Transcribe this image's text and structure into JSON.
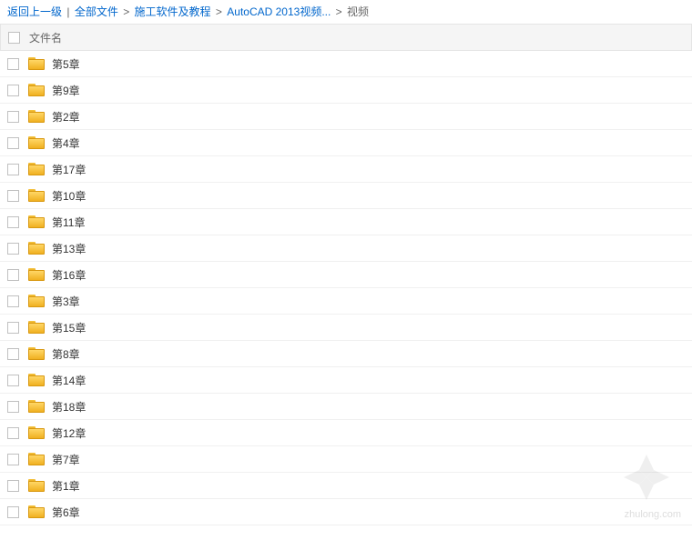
{
  "breadcrumb": {
    "back": "返回上一级",
    "divider": "|",
    "items": [
      {
        "label": "全部文件"
      },
      {
        "label": "施工软件及教程"
      },
      {
        "label": "AutoCAD 2013视频..."
      }
    ],
    "current": "视频"
  },
  "header": {
    "filename_col": "文件名"
  },
  "files": [
    {
      "name": "第5章"
    },
    {
      "name": "第9章"
    },
    {
      "name": "第2章"
    },
    {
      "name": "第4章"
    },
    {
      "name": "第17章"
    },
    {
      "name": "第10章"
    },
    {
      "name": "第11章"
    },
    {
      "name": "第13章"
    },
    {
      "name": "第16章"
    },
    {
      "name": "第3章"
    },
    {
      "name": "第15章"
    },
    {
      "name": "第8章"
    },
    {
      "name": "第14章"
    },
    {
      "name": "第18章"
    },
    {
      "name": "第12章"
    },
    {
      "name": "第7章"
    },
    {
      "name": "第1章"
    },
    {
      "name": "第6章"
    }
  ],
  "watermark": "zhulong.com"
}
